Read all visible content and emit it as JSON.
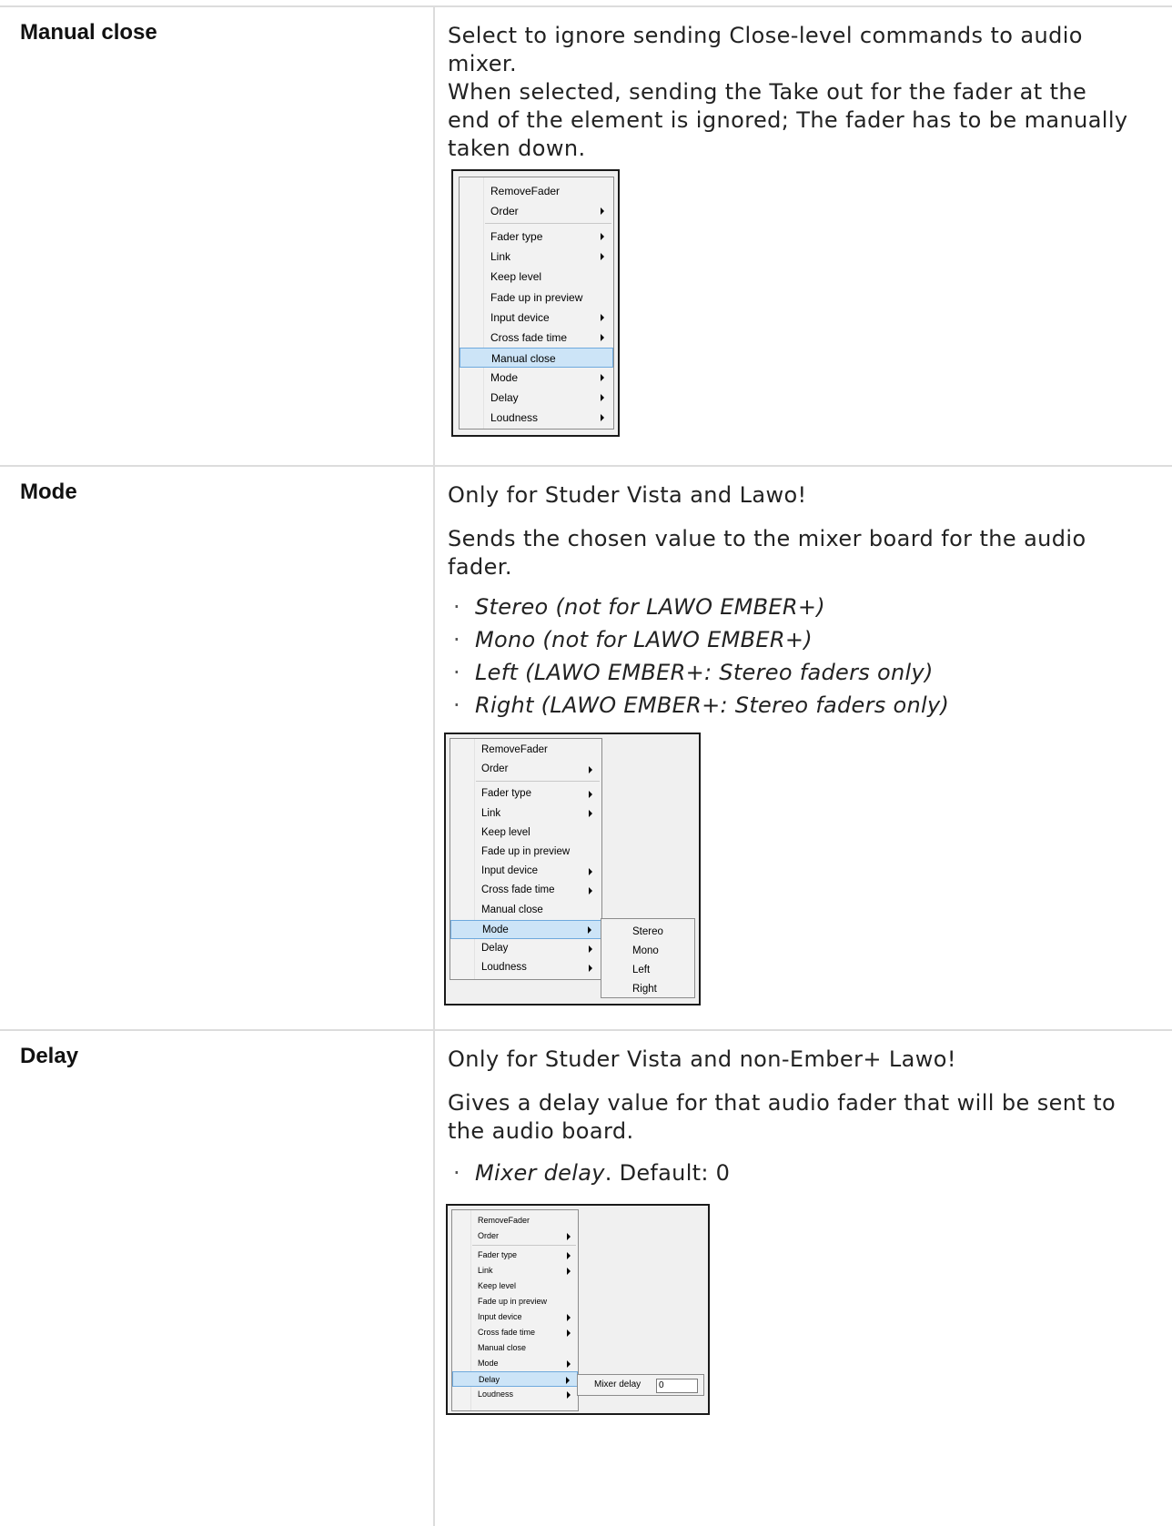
{
  "rows": [
    {
      "term": "Manual close",
      "desc_lines": [
        "Select to ignore sending Close-level commands to audio",
        "mixer.",
        "When selected, sending the Take out for the fader at the",
        "end of the element is ignored; The fader has to be manually",
        "taken down."
      ],
      "menu": {
        "items": [
          {
            "label": "RemoveFader",
            "submenu": false
          },
          {
            "label": "Order",
            "submenu": true
          },
          {
            "label": "Fader type",
            "submenu": true
          },
          {
            "label": "Link",
            "submenu": true
          },
          {
            "label": "Keep level",
            "submenu": false
          },
          {
            "label": "Fade up in preview",
            "submenu": false
          },
          {
            "label": "Input device",
            "submenu": true
          },
          {
            "label": "Cross fade time",
            "submenu": true
          },
          {
            "label": "Manual close",
            "submenu": false,
            "highlighted": true
          },
          {
            "label": "Mode",
            "submenu": true
          },
          {
            "label": "Delay",
            "submenu": true
          },
          {
            "label": "Loudness",
            "submenu": true
          }
        ]
      }
    },
    {
      "term": "Mode",
      "intro": "Only for Studer Vista and Lawo!",
      "desc_lines": [
        "Sends the chosen value to the mixer board for the audio",
        "fader."
      ],
      "bullets": [
        "Stereo (not for LAWO EMBER+)",
        "Mono (not for LAWO EMBER+)",
        "Left (LAWO EMBER+: Stereo faders only)",
        "Right (LAWO EMBER+: Stereo faders only)"
      ],
      "menu": {
        "items": [
          {
            "label": "RemoveFader",
            "submenu": false
          },
          {
            "label": "Order",
            "submenu": true
          },
          {
            "label": "Fader type",
            "submenu": true
          },
          {
            "label": "Link",
            "submenu": true
          },
          {
            "label": "Keep level",
            "submenu": false
          },
          {
            "label": "Fade up in preview",
            "submenu": false
          },
          {
            "label": "Input device",
            "submenu": true
          },
          {
            "label": "Cross fade time",
            "submenu": true
          },
          {
            "label": "Manual close",
            "submenu": false
          },
          {
            "label": "Mode",
            "submenu": true,
            "highlighted": true
          },
          {
            "label": "Delay",
            "submenu": true
          },
          {
            "label": "Loudness",
            "submenu": true
          }
        ],
        "submenu_items": [
          "Stereo",
          "Mono",
          "Left",
          "Right"
        ]
      }
    },
    {
      "term": "Delay",
      "intro": "Only for Studer Vista and non-Ember+ Lawo!",
      "desc_lines": [
        "Gives a delay value for that audio fader that will be sent to",
        "the audio board."
      ],
      "bullet_em": "Mixer delay",
      "bullet_rest": ". Default: 0",
      "menu": {
        "items": [
          {
            "label": "RemoveFader",
            "submenu": false
          },
          {
            "label": "Order",
            "submenu": true
          },
          {
            "label": "Fader type",
            "submenu": true
          },
          {
            "label": "Link",
            "submenu": true
          },
          {
            "label": "Keep level",
            "submenu": false
          },
          {
            "label": "Fade up in preview",
            "submenu": false
          },
          {
            "label": "Input device",
            "submenu": true
          },
          {
            "label": "Cross fade time",
            "submenu": true
          },
          {
            "label": "Manual close",
            "submenu": false
          },
          {
            "label": "Mode",
            "submenu": true
          },
          {
            "label": "Delay",
            "submenu": true,
            "highlighted": true
          },
          {
            "label": "Loudness",
            "submenu": true
          }
        ],
        "submenu_field_label": "Mixer delay",
        "submenu_field_value": "0"
      }
    }
  ],
  "colors": {
    "highlight": "#cce4f7",
    "highlight_border": "#6ea9dd",
    "grid": "#dcdcdc"
  }
}
